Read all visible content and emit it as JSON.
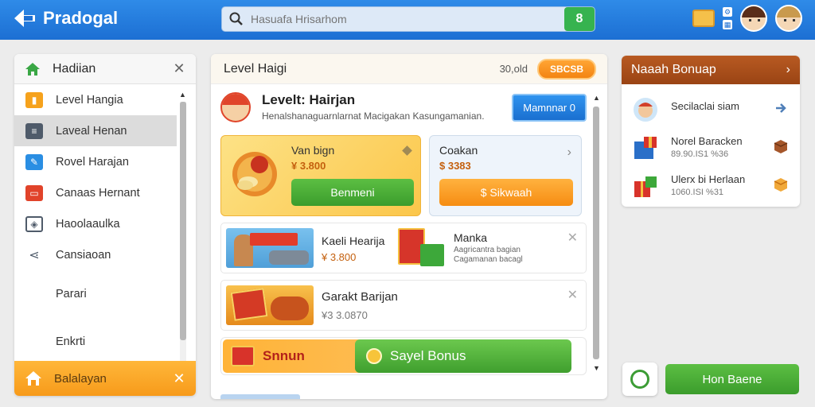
{
  "app": {
    "title": "Pradogal",
    "search_placeholder": "Hasuafa Hrisarhom",
    "search_button": "8"
  },
  "sidebar": {
    "title": "Hadiian",
    "items": [
      {
        "label": "Level Hangia",
        "icon": "bookmark-icon",
        "color": "#f6a21c"
      },
      {
        "label": "Laveal Henan",
        "icon": "list-icon",
        "color": "#4f5b6a"
      },
      {
        "label": "Rovel Harajan",
        "icon": "edit-icon",
        "color": "#2a8ee3"
      },
      {
        "label": "Canaas Hernant",
        "icon": "image-icon",
        "color": "#e1432a"
      },
      {
        "label": "Haoolaaulka",
        "icon": "puzzle-icon",
        "color": "#4f5b6a"
      },
      {
        "label": "Cansiaoan",
        "icon": "share-icon",
        "color": "#4f5b6a"
      },
      {
        "label": "Parari"
      },
      {
        "label": "Enkrti"
      }
    ],
    "footer_label": "Balalayan"
  },
  "center": {
    "title": "Level Haigi",
    "meta": "30,old",
    "pill": "SBCSB",
    "hero": {
      "title": "Levelt: Hairjan",
      "subtitle": "Henalshanaguarnlarnat Macigakan Kasungamanian.",
      "button": "Mamnnar 0"
    },
    "card_yellow": {
      "name": "Van bign",
      "price": "¥ 3.800",
      "button": "Benmeni"
    },
    "card_blue": {
      "name": "Coakan",
      "price": "$ 3383",
      "button": "$ Sikwaah"
    },
    "row1": {
      "name": "Kaeli Hearija",
      "price": "¥ 3.800",
      "name2": "Manka",
      "sub": "Aagricantra bagian\nCagamanan bacagl"
    },
    "row2": {
      "name": "Garakt Barijan",
      "price": "¥3 3.0870"
    },
    "bonus": {
      "left": "Snnun",
      "right": "Sayel Bonus"
    }
  },
  "right_panel": {
    "title": "Naaah Bonuap",
    "items": [
      {
        "title": "Secilaclai siam",
        "sub": ""
      },
      {
        "title": "Norel Baracken",
        "sub": "89.90.IS1 %36"
      },
      {
        "title": "Ulerx bi Herlaan",
        "sub": "1060.ISI %31"
      }
    ]
  },
  "bottom": {
    "button": "Hon Baene"
  },
  "colors": {
    "brand_blue": "#1c6fd3",
    "green": "#3b9c2c",
    "orange": "#f68c12",
    "bonus_header": "#9a4414"
  }
}
